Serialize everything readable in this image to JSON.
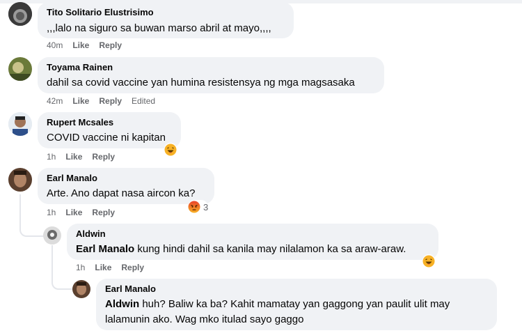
{
  "comments": [
    {
      "author": "Tito Solitario Elustrisimo",
      "text": ",,,lalo na siguro sa buwan marso abril at mayo,,,,",
      "time": "40m",
      "like": "Like",
      "reply": "Reply"
    },
    {
      "author": "Toyama Rainen",
      "text": "dahil sa covid vaccine yan humina resistensya ng mga magsasaka",
      "time": "42m",
      "like": "Like",
      "reply": "Reply",
      "edited": "Edited"
    },
    {
      "author": "Rupert Mcsales",
      "text": "COVID vaccine ni kapitan",
      "time": "1h",
      "like": "Like",
      "reply": "Reply",
      "reaction": "haha"
    },
    {
      "author": "Earl Manalo",
      "text": "Arte. Ano dapat nasa aircon ka?",
      "time": "1h",
      "like": "Like",
      "reply": "Reply",
      "reaction": "angry",
      "reaction_count": "3"
    },
    {
      "author": "Aldwin",
      "mention": "Earl Manalo",
      "text": " kung hindi dahil sa kanila may nilalamon ka sa araw-araw.",
      "time": "1h",
      "like": "Like",
      "reply": "Reply",
      "reaction": "haha"
    },
    {
      "author": "Earl Manalo",
      "mention": "Aldwin",
      "text_line1": " huh? Baliw ka ba? Kahit mamatay yan gaggong yan paulit ulit may",
      "text_line2": "lalamunin ako. Wag mko itulad sayo gaggo"
    }
  ],
  "colors": {
    "bubble": "#f0f2f5",
    "meta": "#65676b",
    "angry": "#e9710f",
    "haha": "#f7b125"
  }
}
